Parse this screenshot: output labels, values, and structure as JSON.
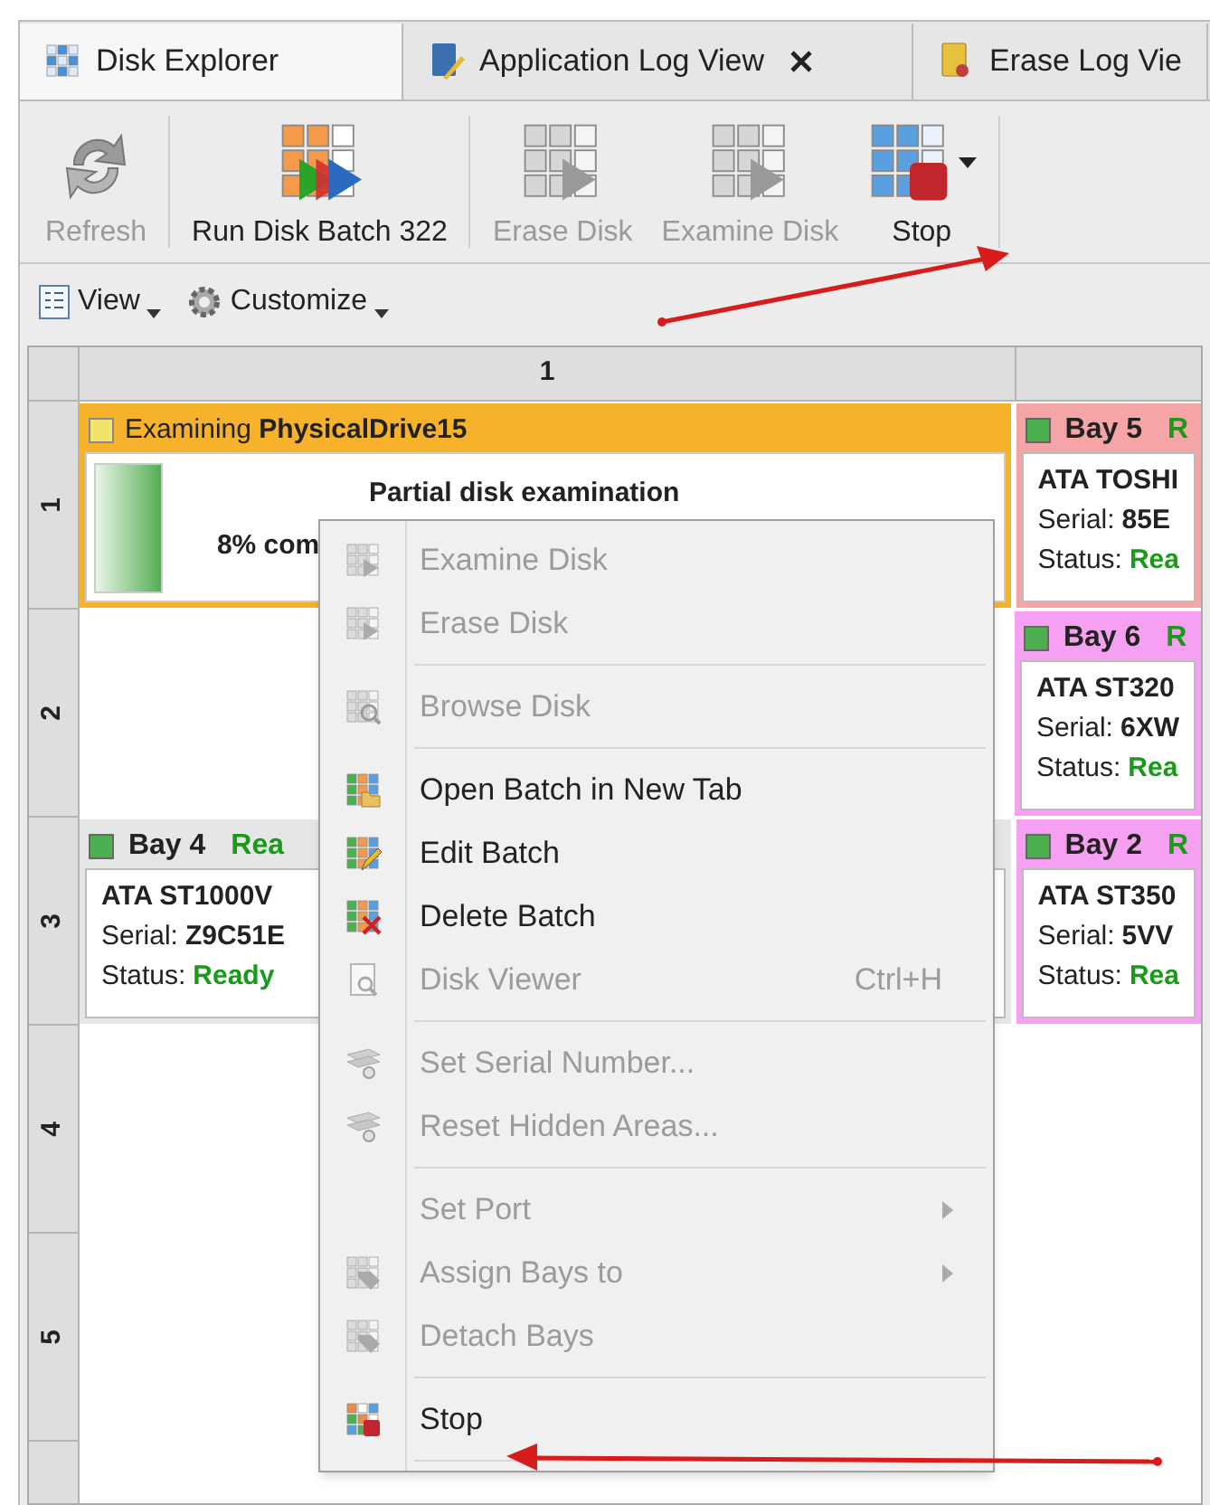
{
  "tabs": [
    {
      "label": "Disk Explorer",
      "selected": true,
      "closable": false
    },
    {
      "label": "Application Log View",
      "selected": false,
      "closable": true
    },
    {
      "label": "Erase Log Vie",
      "selected": false,
      "closable": false
    }
  ],
  "toolbar": [
    {
      "label": "Refresh",
      "disabled": true,
      "dropdown": false
    },
    {
      "label": "Run Disk Batch 322",
      "disabled": false,
      "dropdown": false
    },
    {
      "label": "Erase Disk",
      "disabled": true,
      "dropdown": false
    },
    {
      "label": "Examine Disk",
      "disabled": true,
      "dropdown": false
    },
    {
      "label": "Stop",
      "disabled": false,
      "dropdown": true
    }
  ],
  "view_bar": [
    {
      "label": "View"
    },
    {
      "label": "Customize"
    }
  ],
  "grid": {
    "column_1": "1",
    "rows": [
      {
        "header": "1",
        "cells": [
          {
            "kind": "progress",
            "status": "Examining",
            "drive": "PhysicalDrive15",
            "title": "Partial disk examination",
            "percent": "8% com",
            "color": "#f7b22c"
          },
          {
            "kind": "bay",
            "bay": "Bay 5",
            "state": "R",
            "model": "ATA TOSHI",
            "serial_label": "Serial:",
            "serial": "85E",
            "status_label": "Status:",
            "status": "Rea",
            "color": "#f5a5a5"
          }
        ]
      },
      {
        "header": "2",
        "cells": [
          {
            "kind": "empty"
          },
          {
            "kind": "bay",
            "bay": "Bay 6",
            "state": "R",
            "model": "ATA ST320",
            "serial_label": "Serial:",
            "serial": "6XW",
            "status_label": "Status:",
            "status": "Rea",
            "color": "#f5a0f0"
          }
        ]
      },
      {
        "header": "3",
        "cells": [
          {
            "kind": "bay",
            "bay": "Bay 4",
            "state": "Rea",
            "model": "ATA ST1000V",
            "serial_label": "Serial:",
            "serial": "Z9C51E",
            "status_label": "Status:",
            "status": "Ready",
            "color": "#e6e6e6"
          },
          {
            "kind": "bay",
            "bay": "Bay 2",
            "state": "R",
            "model": "ATA ST350",
            "serial_label": "Serial:",
            "serial": "5VV",
            "status_label": "Status:",
            "status": "Rea",
            "color": "#f5a0f0"
          }
        ]
      },
      {
        "header": "4",
        "cells": [
          {
            "kind": "empty"
          },
          {
            "kind": "empty"
          }
        ]
      },
      {
        "header": "5",
        "cells": [
          {
            "kind": "empty"
          },
          {
            "kind": "empty"
          }
        ]
      }
    ]
  },
  "context_menu": [
    {
      "kind": "item",
      "label": "Examine Disk",
      "disabled": true,
      "submenu": false
    },
    {
      "kind": "item",
      "label": "Erase Disk",
      "disabled": true,
      "submenu": false
    },
    {
      "kind": "separator"
    },
    {
      "kind": "item",
      "label": "Browse Disk",
      "disabled": true,
      "submenu": false
    },
    {
      "kind": "separator"
    },
    {
      "kind": "item",
      "label": "Open Batch in New Tab",
      "disabled": false,
      "submenu": false
    },
    {
      "kind": "item",
      "label": "Edit Batch",
      "disabled": false,
      "submenu": false
    },
    {
      "kind": "item",
      "label": "Delete Batch",
      "disabled": false,
      "submenu": false
    },
    {
      "kind": "item",
      "label": "Disk Viewer",
      "disabled": true,
      "shortcut": "Ctrl+H",
      "submenu": false
    },
    {
      "kind": "separator"
    },
    {
      "kind": "item",
      "label": "Set Serial Number...",
      "disabled": true,
      "submenu": false
    },
    {
      "kind": "item",
      "label": "Reset Hidden Areas...",
      "disabled": true,
      "submenu": false
    },
    {
      "kind": "separator"
    },
    {
      "kind": "item",
      "label": "Set Port",
      "disabled": true,
      "submenu": true
    },
    {
      "kind": "item",
      "label": "Assign Bays to",
      "disabled": true,
      "submenu": true
    },
    {
      "kind": "item",
      "label": "Detach Bays",
      "disabled": true,
      "submenu": false
    },
    {
      "kind": "separator"
    },
    {
      "kind": "item",
      "label": "Stop",
      "disabled": false,
      "submenu": false
    },
    {
      "kind": "separator"
    }
  ]
}
